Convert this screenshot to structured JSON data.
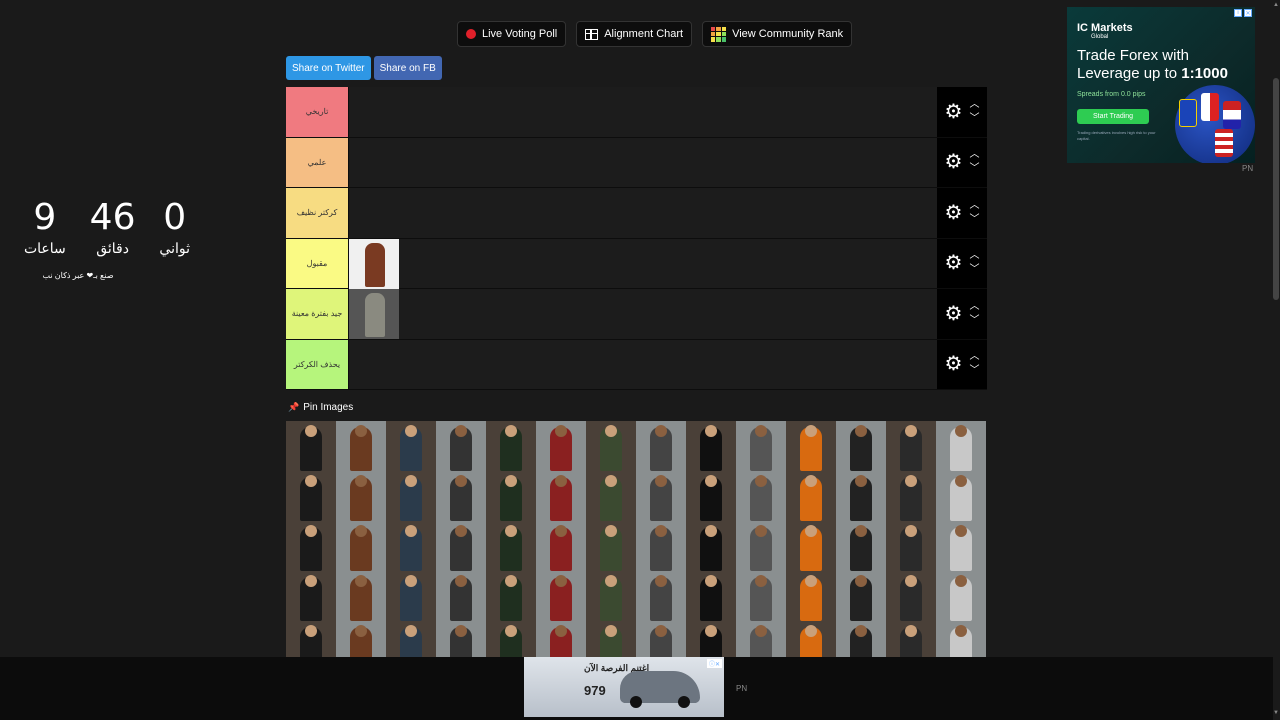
{
  "actions": {
    "live_poll": "Live Voting Poll",
    "alignment": "Alignment Chart",
    "community_rank": "View Community Rank"
  },
  "share": {
    "twitter": "Share on Twitter",
    "facebook": "Share on FB"
  },
  "tiers": [
    {
      "label": "تاريخي",
      "color": "#f07a80"
    },
    {
      "label": "علمي",
      "color": "#f5be84"
    },
    {
      "label": "كركتر نظيف",
      "color": "#f7dc82"
    },
    {
      "label": "مقبول",
      "color": "#fafa84"
    },
    {
      "label": "جيد بفترة معينة",
      "color": "#dff57a"
    },
    {
      "label": "يحذف الكركتر",
      "color": "#b6f57c"
    }
  ],
  "pin_title": "Pin Images",
  "timer": {
    "hours": "9",
    "hours_label": "ساعات",
    "minutes": "46",
    "minutes_label": "دقائق",
    "seconds": "0",
    "seconds_label": "ثواني",
    "made_by": "صنع بـ❤ عبر ذكان نب"
  },
  "ad_right": {
    "brand": "IC Markets",
    "brand_sub": "Global",
    "headline_1": "Trade Forex with",
    "headline_2": "Leverage up to ",
    "headline_bold": "1:1000",
    "sub": "Spreads from 0.0 pips",
    "cta": "Start Trading",
    "disclaimer": "Trading derivatives involves high risk to your capital.",
    "label": "PN"
  },
  "ad_bottom": {
    "headline": "اغتنم الفرصة الآن",
    "price": "979",
    "label": "PN"
  }
}
